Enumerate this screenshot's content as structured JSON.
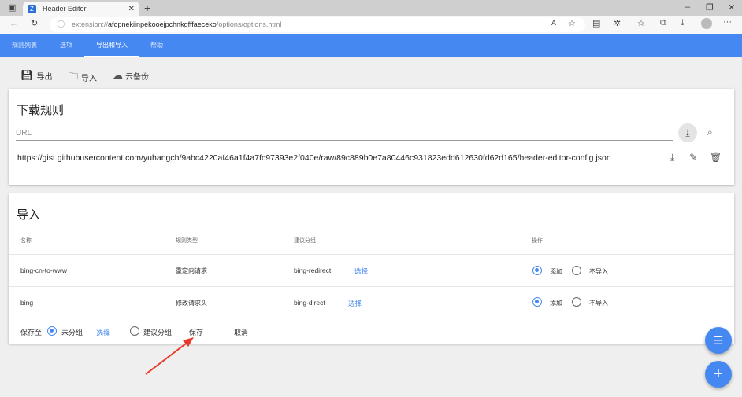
{
  "browser": {
    "tab_title": "Header Editor",
    "url_prefix": "extension://",
    "url_host": "afopnekiinpekooejpchnkgfffaeceko",
    "url_path": "/options/options.html"
  },
  "nav": {
    "tabs": [
      "规则列表",
      "选项",
      "导出和导入",
      "帮助"
    ],
    "active": 2
  },
  "toolbar": {
    "export": "导出",
    "import": "导入",
    "cloud": "云备份"
  },
  "download": {
    "title": "下载规则",
    "url_placeholder": "URL",
    "url_value": "",
    "saved_url": "https://gist.githubusercontent.com/yuhangch/9abc4220af46a1f4a7fc97393e2f040e/raw/89c889b0e7a80446c931823edd612630fd62d165/header-editor-config.json"
  },
  "import": {
    "title": "导入",
    "headers": [
      "名称",
      "规则类型",
      "建议分组",
      "操作"
    ],
    "rows": [
      {
        "name": "bing-cn-to-www",
        "type": "重定向请求",
        "group": "bing-redirect",
        "choose": "选择",
        "add": "添加",
        "skip": "不导入",
        "selected": "add"
      },
      {
        "name": "bing",
        "type": "修改请求头",
        "group": "bing-direct",
        "choose": "选择",
        "add": "添加",
        "skip": "不导入",
        "selected": "add"
      }
    ],
    "save_to": "保存至",
    "ungrouped": "未分组",
    "choose": "选择",
    "suggested": "建议分组",
    "save": "保存",
    "cancel": "取消",
    "selected_target": "ungrouped"
  },
  "colors": {
    "accent": "#4688f1",
    "annotation": "#e8392b"
  }
}
